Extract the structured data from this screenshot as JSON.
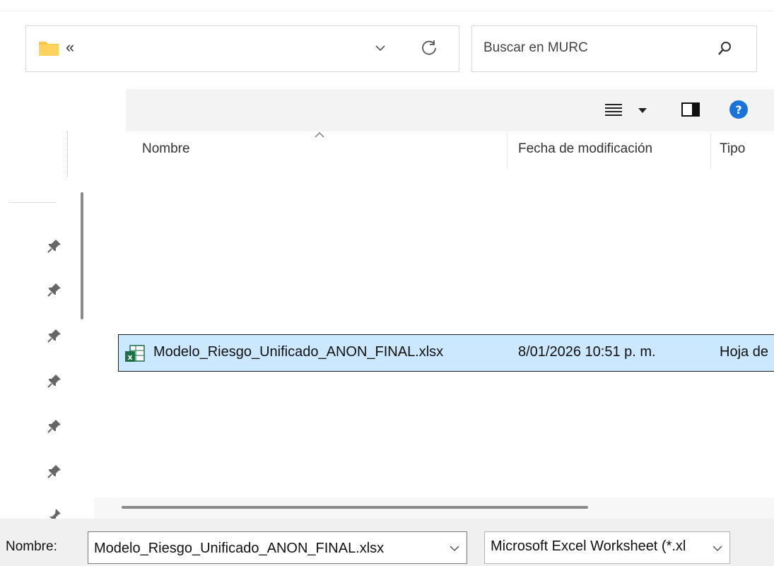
{
  "address_bar": {
    "overflow_label": "«"
  },
  "search": {
    "placeholder": "Buscar en MURC"
  },
  "columns": {
    "name": "Nombre",
    "modified": "Fecha de modificación",
    "type": "Tipo"
  },
  "files": [
    {
      "name": "Modelo_Riesgo_Unificado_ANON_FINAL.xlsx",
      "modified": "8/01/2026 10:51 p. m.",
      "type": "Hoja de"
    }
  ],
  "bottom": {
    "filename_label": "Nombre:",
    "filename_value": "Modelo_Riesgo_Unificado_ANON_FINAL.xlsx",
    "filetype_value": "Microsoft Excel Worksheet (*.xl"
  },
  "colors": {
    "selection": "#cce8ff",
    "help_blue": "#1a73d9",
    "folder_yellow": "#f8c640",
    "excel_green": "#1e7145"
  },
  "icons": {
    "folder": "folder-icon",
    "refresh": "refresh-icon",
    "search": "search-icon",
    "view": "view-menu-icon",
    "preview": "preview-pane-icon",
    "help": "help-icon",
    "pin": "pin-icon",
    "excel": "excel-file-icon"
  }
}
